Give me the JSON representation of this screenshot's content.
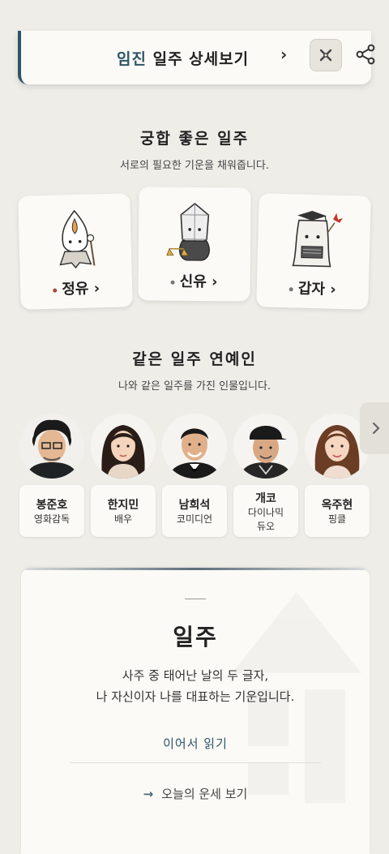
{
  "header": {
    "title_accent": "임진",
    "title_rest": " 일주 상세보기",
    "chevron": "›"
  },
  "compat_section": {
    "title": "궁합 좋은 일주",
    "subtitle": "서로의 필요한 기운을 채워줍니다.",
    "items": [
      {
        "label": "정유 ›",
        "dot_color": "#b0443a",
        "icon": "candle-spirit-icon"
      },
      {
        "label": "신유 ›",
        "dot_color": "#777777",
        "icon": "crystal-scale-icon"
      },
      {
        "label": "갑자 ›",
        "dot_color": "#777777",
        "icon": "tree-scholar-icon"
      }
    ]
  },
  "celeb_section": {
    "title": "같은 일주 연예인",
    "subtitle": "나와 같은 일주를 가진 인물입니다.",
    "people": [
      {
        "name": "봉준호",
        "role": "영화감독"
      },
      {
        "name": "한지민",
        "role": "배우"
      },
      {
        "name": "남희석",
        "role": "코미디언"
      },
      {
        "name": "개코",
        "role": "다이나믹 듀오"
      },
      {
        "name": "옥주현",
        "role": "핑클"
      }
    ]
  },
  "info_card": {
    "title": "일주",
    "text_line1": "사주 중 태어난 날의 두 글자,",
    "text_line2": "나 자신이자 나를 대표하는 기운입니다.",
    "more_label": "이어서 읽기",
    "link_label": "오늘의 운세 보기"
  },
  "colors": {
    "accent": "#2e5566",
    "background": "#efede8",
    "card": "#fbfaf6"
  }
}
